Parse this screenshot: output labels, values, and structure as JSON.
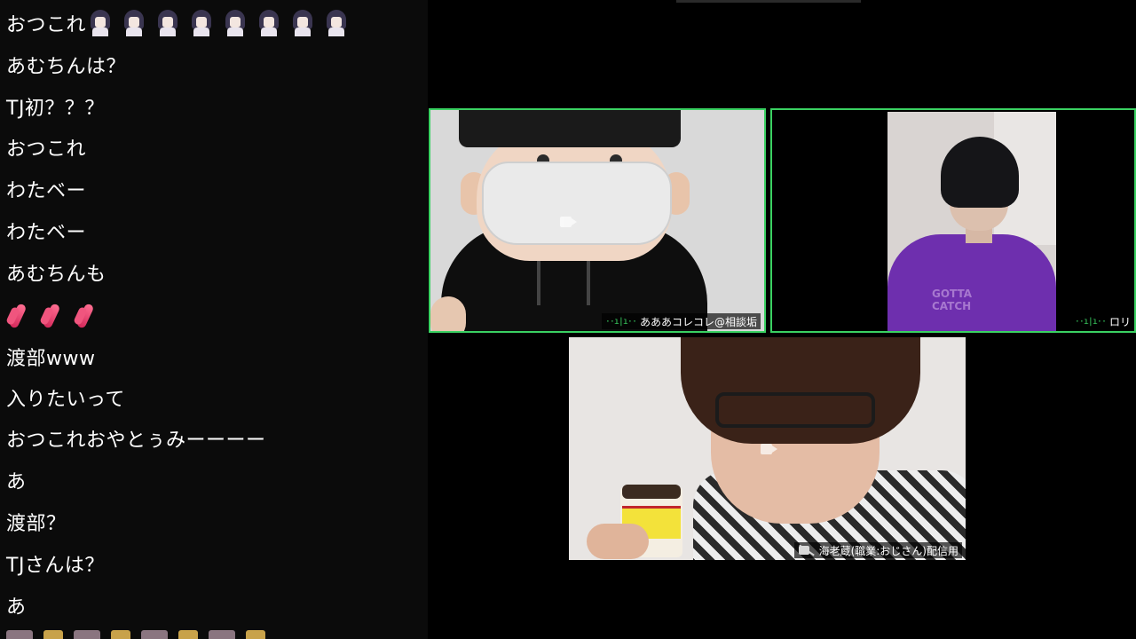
{
  "chat": {
    "messages": [
      {
        "text": "おつこれ",
        "emote": "girl",
        "emote_count": 8
      },
      {
        "text": "あむちんは？"
      },
      {
        "text": "TJ初？？？"
      },
      {
        "text": "おつこれ"
      },
      {
        "text": "わたベー"
      },
      {
        "text": "わたベー"
      },
      {
        "text": "あむちんも"
      },
      {
        "text": "",
        "emote": "praying-hands",
        "emote_count": 3
      },
      {
        "text": "渡部www"
      },
      {
        "text": "入りたいって"
      },
      {
        "text": "おつこれおやとぅみーーーー"
      },
      {
        "text": "あ"
      },
      {
        "text": "渡部？"
      },
      {
        "text": "TJさんは？"
      },
      {
        "text": "あ"
      }
    ]
  },
  "tiles": [
    {
      "name": "あああコレコレ@相談垢",
      "camera": "off",
      "speaking": true,
      "accent": "#3ad162"
    },
    {
      "name": "ロリ",
      "camera": "on",
      "speaking": true,
      "accent": "#3ad162",
      "shirt_text": "GOTTA CATCH"
    },
    {
      "name": "海老蔵(職業:おじさん)配信用",
      "camera": "off",
      "muted": true
    }
  ]
}
